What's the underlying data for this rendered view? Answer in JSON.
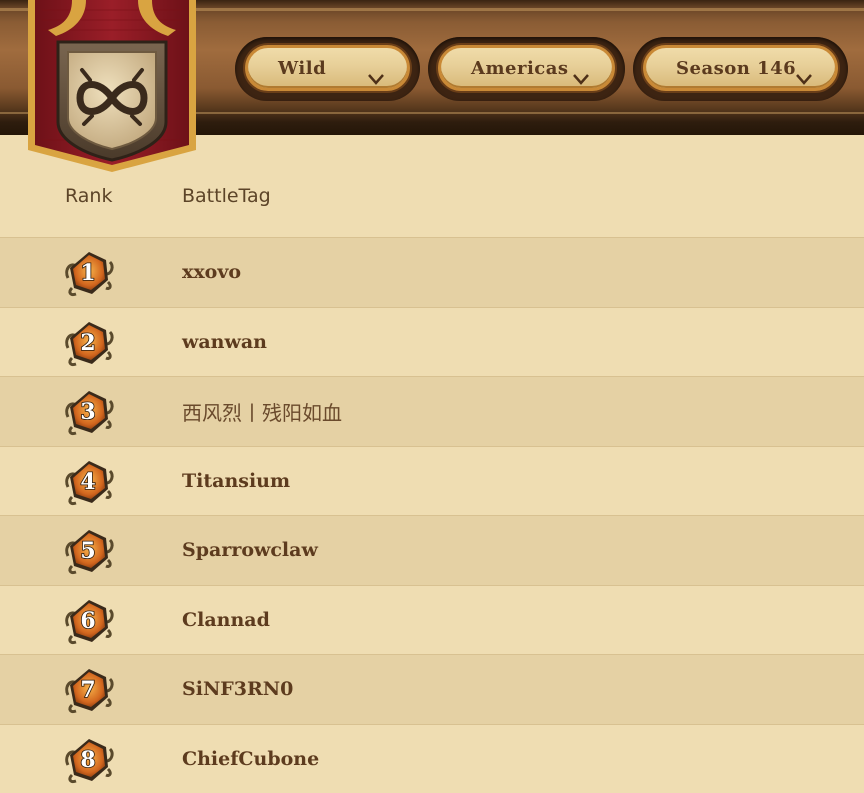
{
  "filters": {
    "mode": "Wild",
    "region": "Americas",
    "season": "Season 146"
  },
  "icons": {
    "emblem": "infinity-emblem-icon",
    "dropdown": "chevron-down-icon",
    "rank_badge": "rank-badge-icon"
  },
  "table": {
    "headers": {
      "rank": "Rank",
      "battletag": "BattleTag"
    },
    "rows": [
      {
        "rank": "1",
        "battletag": "xxovo"
      },
      {
        "rank": "2",
        "battletag": "wanwan"
      },
      {
        "rank": "3",
        "battletag": "西风烈丨残阳如血"
      },
      {
        "rank": "4",
        "battletag": "Titansium"
      },
      {
        "rank": "5",
        "battletag": "Sparrowclaw"
      },
      {
        "rank": "6",
        "battletag": "Clannad"
      },
      {
        "rank": "7",
        "battletag": "SiNF3RN0"
      },
      {
        "rank": "8",
        "battletag": "ChiefCubone"
      }
    ]
  },
  "colors": {
    "banner_red": "#8e1a22",
    "wood_brown": "#8a5a32",
    "gold_trim": "#d9a441",
    "text_brown": "#5d3b1e",
    "row_alt": "#e5d1a4"
  }
}
